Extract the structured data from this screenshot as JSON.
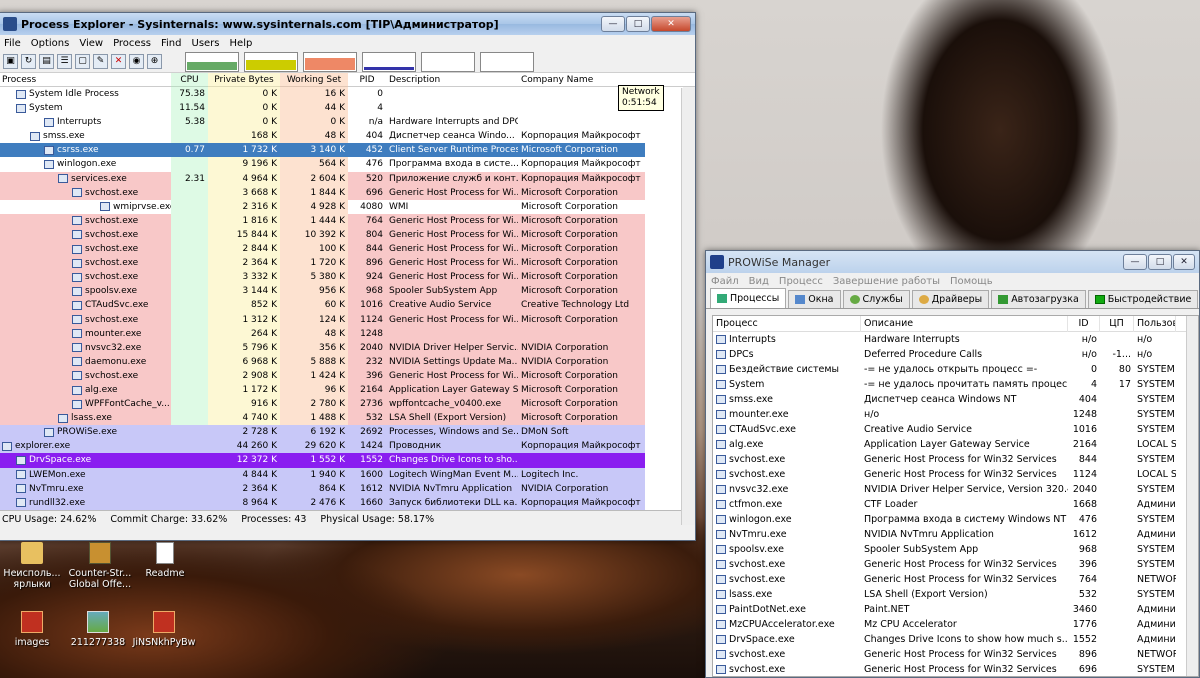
{
  "pe": {
    "title": "Process Explorer - Sysinternals: www.sysinternals.com [TIP\\Администратор]",
    "menu": [
      "File",
      "Options",
      "View",
      "Process",
      "Find",
      "Users",
      "Help"
    ],
    "columns": [
      "Process",
      "CPU",
      "Private Bytes",
      "Working Set",
      "PID",
      "Description",
      "Company Name"
    ],
    "tooltip": {
      "line1": "Network",
      "line2": "0:51:54"
    },
    "rows": [
      {
        "name": "System Idle Process",
        "cpu": "75.38",
        "priv": "0 K",
        "ws": "16 K",
        "pid": "0",
        "desc": "",
        "co": "",
        "style": ""
      },
      {
        "name": "System",
        "cpu": "11.54",
        "priv": "0 K",
        "ws": "44 K",
        "pid": "4",
        "desc": "",
        "co": "",
        "style": ""
      },
      {
        "name": "Interrupts",
        "cpu": "5.38",
        "priv": "0 K",
        "ws": "0 K",
        "pid": "n/a",
        "desc": "Hardware Interrupts and DPCs",
        "co": "",
        "style": ""
      },
      {
        "name": "smss.exe",
        "cpu": "",
        "priv": "168 K",
        "ws": "48 K",
        "pid": "404",
        "desc": "Диспетчер сеанса  Windo...",
        "co": "Корпорация Майкрософт",
        "style": ""
      },
      {
        "name": "csrss.exe",
        "cpu": "0.77",
        "priv": "1 732 K",
        "ws": "3 140 K",
        "pid": "452",
        "desc": "Client Server Runtime Process",
        "co": "Microsoft Corporation",
        "style": "sel"
      },
      {
        "name": "winlogon.exe",
        "cpu": "",
        "priv": "9 196 K",
        "ws": "564 K",
        "pid": "476",
        "desc": "Программа входа в систе...",
        "co": "Корпорация Майкрософт",
        "style": ""
      },
      {
        "name": "services.exe",
        "cpu": "2.31",
        "priv": "4 964 K",
        "ws": "2 604 K",
        "pid": "520",
        "desc": "Приложение служб и конт...",
        "co": "Корпорация Майкрософт",
        "style": "pink"
      },
      {
        "name": "svchost.exe",
        "cpu": "",
        "priv": "3 668 K",
        "ws": "1 844 K",
        "pid": "696",
        "desc": "Generic Host Process for Wi...",
        "co": "Microsoft Corporation",
        "style": "pink"
      },
      {
        "name": "wmiprvse.exe",
        "cpu": "",
        "priv": "2 316 K",
        "ws": "4 928 K",
        "pid": "4080",
        "desc": "WMI",
        "co": "Microsoft Corporation",
        "style": ""
      },
      {
        "name": "svchost.exe",
        "cpu": "",
        "priv": "1 816 K",
        "ws": "1 444 K",
        "pid": "764",
        "desc": "Generic Host Process for Wi...",
        "co": "Microsoft Corporation",
        "style": "pink"
      },
      {
        "name": "svchost.exe",
        "cpu": "",
        "priv": "15 844 K",
        "ws": "10 392 K",
        "pid": "804",
        "desc": "Generic Host Process for Wi...",
        "co": "Microsoft Corporation",
        "style": "pink"
      },
      {
        "name": "svchost.exe",
        "cpu": "",
        "priv": "2 844 K",
        "ws": "100 K",
        "pid": "844",
        "desc": "Generic Host Process for Wi...",
        "co": "Microsoft Corporation",
        "style": "pink"
      },
      {
        "name": "svchost.exe",
        "cpu": "",
        "priv": "2 364 K",
        "ws": "1 720 K",
        "pid": "896",
        "desc": "Generic Host Process for Wi...",
        "co": "Microsoft Corporation",
        "style": "pink"
      },
      {
        "name": "svchost.exe",
        "cpu": "",
        "priv": "3 332 K",
        "ws": "5 380 K",
        "pid": "924",
        "desc": "Generic Host Process for Wi...",
        "co": "Microsoft Corporation",
        "style": "pink"
      },
      {
        "name": "spoolsv.exe",
        "cpu": "",
        "priv": "3 144 K",
        "ws": "956 K",
        "pid": "968",
        "desc": "Spooler SubSystem App",
        "co": "Microsoft Corporation",
        "style": "pink"
      },
      {
        "name": "CTAudSvc.exe",
        "cpu": "",
        "priv": "852 K",
        "ws": "60 K",
        "pid": "1016",
        "desc": "Creative Audio Service",
        "co": "Creative Technology Ltd",
        "style": "pink"
      },
      {
        "name": "svchost.exe",
        "cpu": "",
        "priv": "1 312 K",
        "ws": "124 K",
        "pid": "1124",
        "desc": "Generic Host Process for Wi...",
        "co": "Microsoft Corporation",
        "style": "pink"
      },
      {
        "name": "mounter.exe",
        "cpu": "",
        "priv": "264 K",
        "ws": "48 K",
        "pid": "1248",
        "desc": "",
        "co": "",
        "style": "pink"
      },
      {
        "name": "nvsvc32.exe",
        "cpu": "",
        "priv": "5 796 K",
        "ws": "356 K",
        "pid": "2040",
        "desc": "NVIDIA Driver Helper Servic...",
        "co": "NVIDIA Corporation",
        "style": "pink"
      },
      {
        "name": "daemonu.exe",
        "cpu": "",
        "priv": "6 968 K",
        "ws": "5 888 K",
        "pid": "232",
        "desc": "NVIDIA Settings Update Ma...",
        "co": "NVIDIA Corporation",
        "style": "pink"
      },
      {
        "name": "svchost.exe",
        "cpu": "",
        "priv": "2 908 K",
        "ws": "1 424 K",
        "pid": "396",
        "desc": "Generic Host Process for Wi...",
        "co": "Microsoft Corporation",
        "style": "pink"
      },
      {
        "name": "alg.exe",
        "cpu": "",
        "priv": "1 172 K",
        "ws": "96 K",
        "pid": "2164",
        "desc": "Application Layer Gateway S...",
        "co": "Microsoft Corporation",
        "style": "pink"
      },
      {
        "name": "WPFFontCache_v...",
        "cpu": "",
        "priv": "916 K",
        "ws": "2 780 K",
        "pid": "2736",
        "desc": "wpffontcache_v0400.exe",
        "co": "Microsoft Corporation",
        "style": "pink"
      },
      {
        "name": "lsass.exe",
        "cpu": "",
        "priv": "4 740 K",
        "ws": "1 488 K",
        "pid": "532",
        "desc": "LSA Shell (Export Version)",
        "co": "Microsoft Corporation",
        "style": "pink"
      },
      {
        "name": "PROWiSe.exe",
        "cpu": "",
        "priv": "2 728 K",
        "ws": "6 192 K",
        "pid": "2692",
        "desc": "Processes, Windows and Se...",
        "co": "DMoN Soft",
        "style": "blue"
      },
      {
        "name": "explorer.exe",
        "cpu": "",
        "priv": "44 260 K",
        "ws": "29 620 K",
        "pid": "1424",
        "desc": "Проводник",
        "co": "Корпорация Майкрософт",
        "style": "blue"
      },
      {
        "name": "DrvSpace.exe",
        "cpu": "",
        "priv": "12 372 K",
        "ws": "1 552 K",
        "pid": "1552",
        "desc": "Changes Drive Icons to sho...",
        "co": "",
        "style": "purple"
      },
      {
        "name": "LWEMon.exe",
        "cpu": "",
        "priv": "4 844 K",
        "ws": "1 940 K",
        "pid": "1600",
        "desc": "Logitech WingMan Event M...",
        "co": "Logitech Inc.",
        "style": "blue"
      },
      {
        "name": "NvTmru.exe",
        "cpu": "",
        "priv": "2 364 K",
        "ws": "864 K",
        "pid": "1612",
        "desc": "NVIDIA NvTmru Application",
        "co": "NVIDIA Corporation",
        "style": "blue"
      },
      {
        "name": "rundll32.exe",
        "cpu": "",
        "priv": "8 964 K",
        "ws": "2 476 K",
        "pid": "1660",
        "desc": "Запуск библиотеки DLL ка...",
        "co": "Корпорация Майкрософт",
        "style": "blue"
      }
    ],
    "status": {
      "cpu": "CPU Usage: 24.62%",
      "commit": "Commit Charge: 33.62%",
      "procs": "Processes: 43",
      "phys": "Physical Usage: 58.17%"
    }
  },
  "desktop_icons": [
    {
      "label": "Неисполь... ярлыки"
    },
    {
      "label": "Counter-Str... Global Offe..."
    },
    {
      "label": "Readme"
    },
    {
      "label": "images"
    },
    {
      "label": "211277338"
    },
    {
      "label": "JiNSNkhPyBw"
    }
  ],
  "pw": {
    "title": "PROWiSe Manager",
    "menu": [
      "Файл",
      "Вид",
      "Процесс",
      "Завершение работы",
      "Помощь"
    ],
    "tabs": [
      "Процессы",
      "Окна",
      "Службы",
      "Драйверы",
      "Автозагрузка",
      "Быстродействие"
    ],
    "columns": [
      "Процесс",
      "Описание",
      "ID",
      "ЦП",
      "Пользов"
    ],
    "rows": [
      {
        "name": "Interrupts",
        "desc": "Hardware Interrupts",
        "id": "н/о",
        "cpu": "",
        "user": "н/о"
      },
      {
        "name": "DPCs",
        "desc": "Deferred Procedure Calls",
        "id": "н/о",
        "cpu": "-1...",
        "user": "н/о"
      },
      {
        "name": "Бездействие системы",
        "desc": "-= не удалось открыть процесс =-",
        "id": "0",
        "cpu": "80",
        "user": "SYSTEM"
      },
      {
        "name": "System",
        "desc": "-= не удалось прочитать память процес...",
        "id": "4",
        "cpu": "17",
        "user": "SYSTEM"
      },
      {
        "name": "smss.exe",
        "desc": "Диспетчер сеанса  Windows NT",
        "id": "404",
        "cpu": "",
        "user": "SYSTEM"
      },
      {
        "name": "mounter.exe",
        "desc": "н/о",
        "id": "1248",
        "cpu": "",
        "user": "SYSTEM"
      },
      {
        "name": "CTAudSvc.exe",
        "desc": "Creative Audio Service",
        "id": "1016",
        "cpu": "",
        "user": "SYSTEM"
      },
      {
        "name": "alg.exe",
        "desc": "Application Layer Gateway Service",
        "id": "2164",
        "cpu": "",
        "user": "LOCAL SE"
      },
      {
        "name": "svchost.exe",
        "desc": "Generic Host Process for Win32 Services",
        "id": "844",
        "cpu": "",
        "user": "SYSTEM"
      },
      {
        "name": "svchost.exe",
        "desc": "Generic Host Process for Win32 Services",
        "id": "1124",
        "cpu": "",
        "user": "LOCAL SE"
      },
      {
        "name": "nvsvc32.exe",
        "desc": "NVIDIA Driver Helper Service, Version 320.49",
        "id": "2040",
        "cpu": "",
        "user": "SYSTEM"
      },
      {
        "name": "ctfmon.exe",
        "desc": "CTF Loader",
        "id": "1668",
        "cpu": "",
        "user": "Админист"
      },
      {
        "name": "winlogon.exe",
        "desc": "Программа входа в систему Windows NT",
        "id": "476",
        "cpu": "",
        "user": "SYSTEM"
      },
      {
        "name": "NvTmru.exe",
        "desc": "NVIDIA NvTmru Application",
        "id": "1612",
        "cpu": "",
        "user": "Админист"
      },
      {
        "name": "spoolsv.exe",
        "desc": "Spooler SubSystem App",
        "id": "968",
        "cpu": "",
        "user": "SYSTEM"
      },
      {
        "name": "svchost.exe",
        "desc": "Generic Host Process for Win32 Services",
        "id": "396",
        "cpu": "",
        "user": "SYSTEM"
      },
      {
        "name": "svchost.exe",
        "desc": "Generic Host Process for Win32 Services",
        "id": "764",
        "cpu": "",
        "user": "NETWORK"
      },
      {
        "name": "lsass.exe",
        "desc": "LSA Shell (Export Version)",
        "id": "532",
        "cpu": "",
        "user": "SYSTEM"
      },
      {
        "name": "PaintDotNet.exe",
        "desc": "Paint.NET",
        "id": "3460",
        "cpu": "",
        "user": "Админист"
      },
      {
        "name": "MzCPUAccelerator.exe",
        "desc": "Mz CPU Accelerator",
        "id": "1776",
        "cpu": "",
        "user": "Админист"
      },
      {
        "name": "DrvSpace.exe",
        "desc": "Changes Drive Icons to show how much s...",
        "id": "1552",
        "cpu": "",
        "user": "Админист"
      },
      {
        "name": "svchost.exe",
        "desc": "Generic Host Process for Win32 Services",
        "id": "896",
        "cpu": "",
        "user": "NETWORK"
      },
      {
        "name": "svchost.exe",
        "desc": "Generic Host Process for Win32 Services",
        "id": "696",
        "cpu": "",
        "user": "SYSTEM"
      }
    ]
  }
}
